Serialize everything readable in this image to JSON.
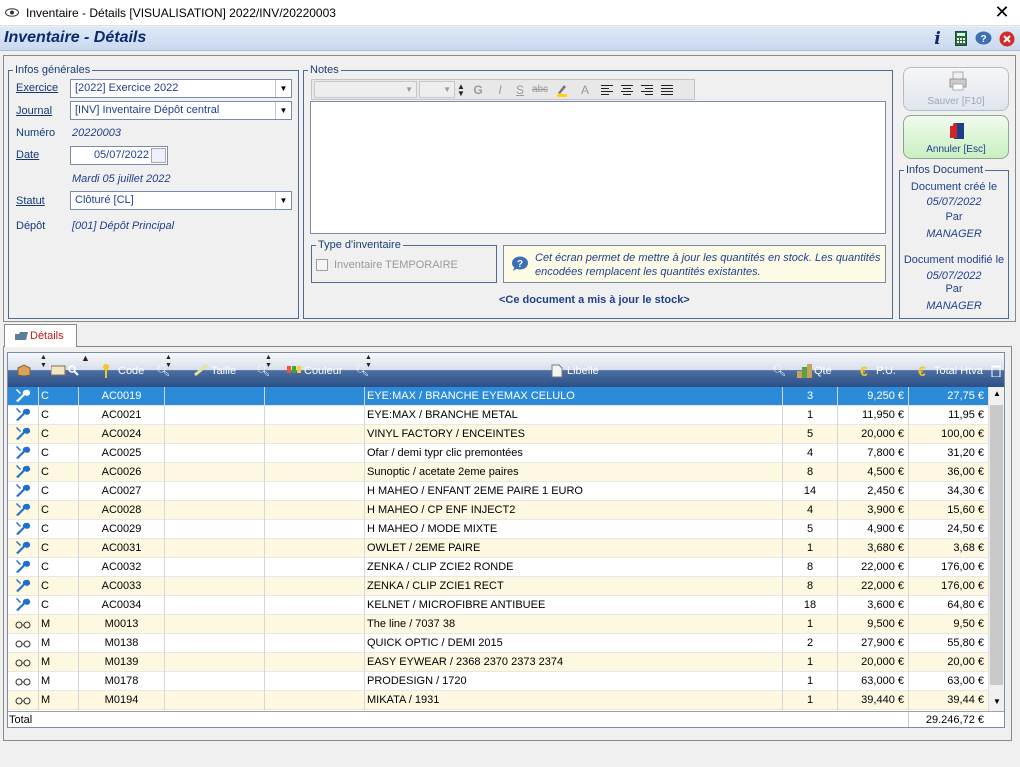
{
  "window": {
    "title": "Inventaire - Détails [VISUALISATION] 2022/INV/20220003"
  },
  "header": {
    "title": "Inventaire - Détails"
  },
  "infos": {
    "legend": "Infos générales",
    "exercice_label": "Exercice",
    "exercice_value": "[2022] Exercice 2022",
    "journal_label": "Journal",
    "journal_value": "[INV] Inventaire Dépôt central",
    "numero_label": "Numéro",
    "numero_value": "20220003",
    "date_label": "Date",
    "date_value": "05/07/2022",
    "date_long": "Mardi 05 juillet 2022",
    "statut_label": "Statut",
    "statut_value": "Clôturé [CL]",
    "depot_label": "Dépôt",
    "depot_value": "[001] Dépôt Principal"
  },
  "notes": {
    "legend": "Notes"
  },
  "type_inventaire": {
    "legend": "Type d'inventaire",
    "checkbox_label": "Inventaire TEMPORAIRE"
  },
  "info_message": "Cet écran permet de mettre à jour les quantités en stock. Les quantités encodées remplacent les quantités existantes.",
  "stock_message": "<Ce document a mis à jour le stock>",
  "buttons": {
    "save": "Sauver [F10]",
    "cancel": "Annuler [Esc]"
  },
  "doc_info": {
    "legend": "Infos Document",
    "created_label": "Document créé le",
    "created_date": "05/07/2022",
    "par1": "Par",
    "created_by": "MANAGER",
    "modified_label": "Document modifié le",
    "modified_date": "05/07/2022",
    "par2": "Par",
    "modified_by": "MANAGER"
  },
  "tab": {
    "label": "Détails"
  },
  "grid": {
    "columns": {
      "code": "Code",
      "taille": "Taille",
      "couleur": "Couleur",
      "libelle": "Libellé",
      "qte": "Qté",
      "pu": "P.U.",
      "total": "Total Htva"
    },
    "rows": [
      {
        "icon": "tools",
        "type": "C",
        "code": "AC0019",
        "libelle": "EYE:MAX / BRANCHE EYEMAX CELULO",
        "qte": "3",
        "pu": "9,250 €",
        "total": "27,75 €"
      },
      {
        "icon": "tools",
        "type": "C",
        "code": "AC0021",
        "libelle": "EYE:MAX / BRANCHE METAL",
        "qte": "1",
        "pu": "11,950 €",
        "total": "11,95 €"
      },
      {
        "icon": "tools",
        "type": "C",
        "code": "AC0024",
        "libelle": "VINYL FACTORY / ENCEINTES",
        "qte": "5",
        "pu": "20,000 €",
        "total": "100,00 €"
      },
      {
        "icon": "tools",
        "type": "C",
        "code": "AC0025",
        "libelle": "Ofar / demi typr clic premontées",
        "qte": "4",
        "pu": "7,800 €",
        "total": "31,20 €"
      },
      {
        "icon": "tools",
        "type": "C",
        "code": "AC0026",
        "libelle": "Sunoptic / acetate 2eme paires",
        "qte": "8",
        "pu": "4,500 €",
        "total": "36,00 €"
      },
      {
        "icon": "tools",
        "type": "C",
        "code": "AC0027",
        "libelle": "H MAHEO / ENFANT 2EME PAIRE 1 EURO",
        "qte": "14",
        "pu": "2,450 €",
        "total": "34,30 €"
      },
      {
        "icon": "tools",
        "type": "C",
        "code": "AC0028",
        "libelle": "H MAHEO / CP ENF INJECT2",
        "qte": "4",
        "pu": "3,900 €",
        "total": "15,60 €"
      },
      {
        "icon": "tools",
        "type": "C",
        "code": "AC0029",
        "libelle": "H MAHEO / MODE MIXTE",
        "qte": "5",
        "pu": "4,900 €",
        "total": "24,50 €"
      },
      {
        "icon": "tools",
        "type": "C",
        "code": "AC0031",
        "libelle": "OWLET / 2EME PAIRE",
        "qte": "1",
        "pu": "3,680 €",
        "total": "3,68 €"
      },
      {
        "icon": "tools",
        "type": "C",
        "code": "AC0032",
        "libelle": "ZENKA / CLIP ZCIE2 RONDE",
        "qte": "8",
        "pu": "22,000 €",
        "total": "176,00 €"
      },
      {
        "icon": "tools",
        "type": "C",
        "code": "AC0033",
        "libelle": "ZENKA / CLIP ZCIE1 RECT",
        "qte": "8",
        "pu": "22,000 €",
        "total": "176,00 €"
      },
      {
        "icon": "tools",
        "type": "C",
        "code": "AC0034",
        "libelle": "KELNET / MICROFIBRE ANTIBUEE",
        "qte": "18",
        "pu": "3,600 €",
        "total": "64,80 €"
      },
      {
        "icon": "glasses",
        "type": "M",
        "code": "M0013",
        "libelle": "The line / 7037 38",
        "qte": "1",
        "pu": "9,500 €",
        "total": "9,50 €"
      },
      {
        "icon": "glasses",
        "type": "M",
        "code": "M0138",
        "libelle": "QUICK OPTIC / DEMI 2015",
        "qte": "2",
        "pu": "27,900 €",
        "total": "55,80 €"
      },
      {
        "icon": "glasses",
        "type": "M",
        "code": "M0139",
        "libelle": "EASY EYWEAR / 2368 2370 2373 2374",
        "qte": "1",
        "pu": "20,000 €",
        "total": "20,00 €"
      },
      {
        "icon": "glasses",
        "type": "M",
        "code": "M0178",
        "libelle": "PRODESIGN / 1720",
        "qte": "1",
        "pu": "63,000 €",
        "total": "63,00 €"
      },
      {
        "icon": "glasses",
        "type": "M",
        "code": "M0194",
        "libelle": "MIKATA / 1931",
        "qte": "1",
        "pu": "39,440 €",
        "total": "39,44 €"
      }
    ],
    "total_label": "Total",
    "total_value": "29.246,72 €"
  },
  "colors": {
    "selected_row": "#2b8bd8",
    "header_text": "#0b2a6f",
    "odd_row": "#fdf8df"
  }
}
